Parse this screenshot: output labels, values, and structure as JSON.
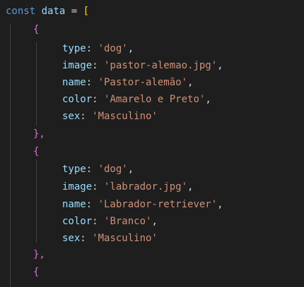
{
  "theme": {
    "background": "#1e1e1e",
    "keyword": "#569cd6",
    "variable": "#9cdcfe",
    "string": "#ce9178",
    "punctuation": "#d4d4d4",
    "bracket_outer": "#ffd700",
    "bracket_inner": "#da70d6"
  },
  "code": {
    "line1": {
      "keyword": "const",
      "name": "data",
      "op": "=",
      "open": "["
    },
    "obj1": {
      "open": "{",
      "type_key": "type",
      "type_val": "'dog'",
      "image_key": "image",
      "image_val": "'pastor-alemao.jpg'",
      "name_key": "name",
      "name_val": "'Pastor-alemão'",
      "color_key": "color",
      "color_val": "'Amarelo e Preto'",
      "sex_key": "sex",
      "sex_val": "'Masculino'",
      "close": "},"
    },
    "obj2": {
      "open": "{",
      "type_key": "type",
      "type_val": "'dog'",
      "image_key": "image",
      "image_val": "'labrador.jpg'",
      "name_key": "name",
      "name_val": "'Labrador-retriever'",
      "color_key": "color",
      "color_val": "'Branco'",
      "sex_key": "sex",
      "sex_val": "'Masculino'",
      "close": "},"
    },
    "obj3": {
      "open": "{"
    }
  }
}
